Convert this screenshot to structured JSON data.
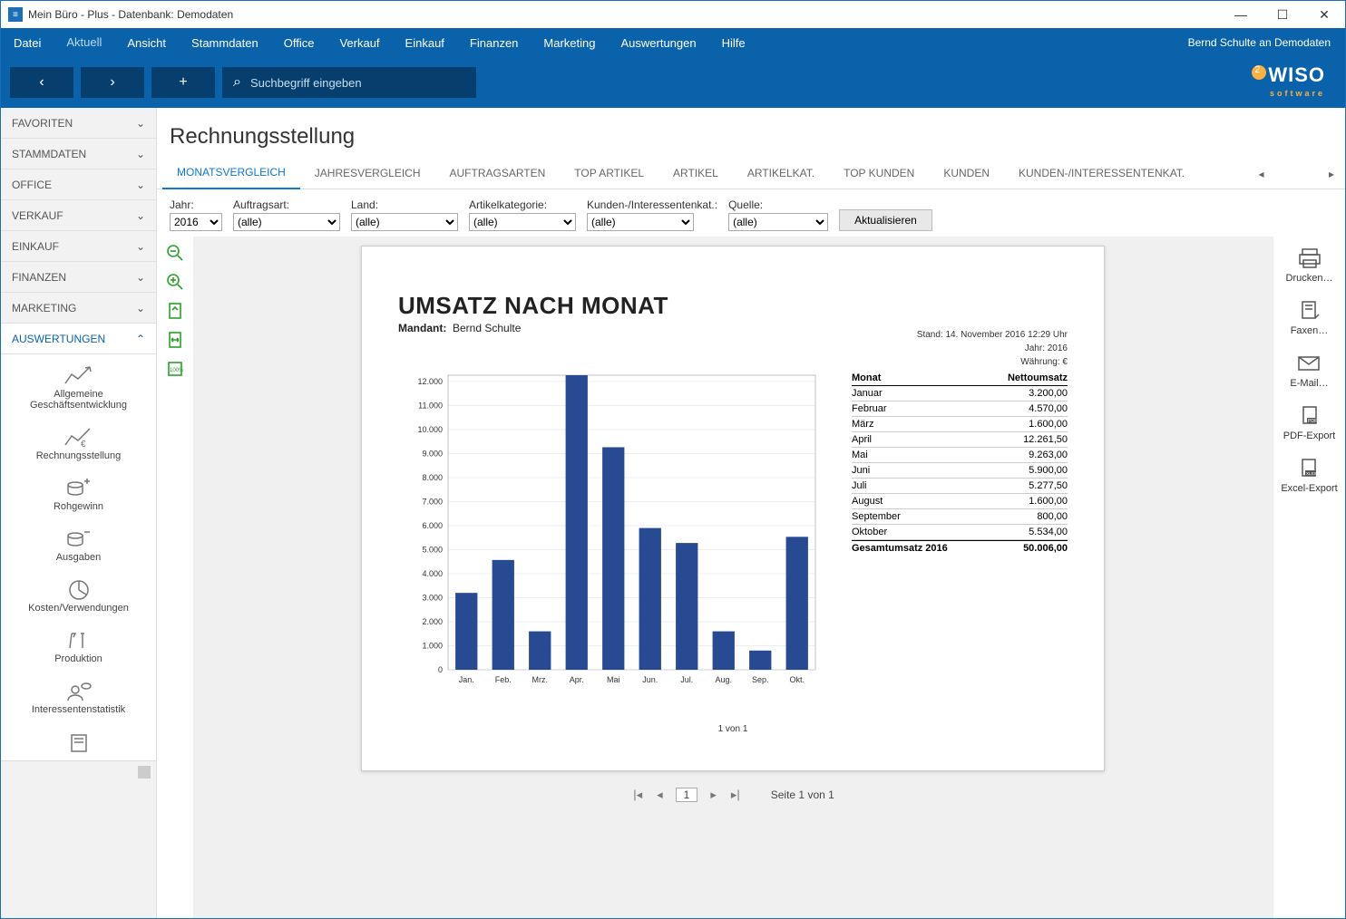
{
  "window": {
    "title": "Mein Büro - Plus - Datenbank: Demodaten"
  },
  "menu": {
    "items": [
      "Datei",
      "Aktuell",
      "Ansicht",
      "Stammdaten",
      "Office",
      "Verkauf",
      "Einkauf",
      "Finanzen",
      "Marketing",
      "Auswertungen",
      "Hilfe"
    ],
    "active_index": 1,
    "user": "Bernd Schulte an Demodaten"
  },
  "toolbar": {
    "search_placeholder": "Suchbegriff eingeben"
  },
  "logo": {
    "brand": "WISO",
    "sub": "software"
  },
  "sidebar": {
    "categories": [
      {
        "label": "FAVORITEN",
        "expanded": false
      },
      {
        "label": "STAMMDATEN",
        "expanded": false
      },
      {
        "label": "OFFICE",
        "expanded": false
      },
      {
        "label": "VERKAUF",
        "expanded": false
      },
      {
        "label": "EINKAUF",
        "expanded": false
      },
      {
        "label": "FINANZEN",
        "expanded": false
      },
      {
        "label": "MARKETING",
        "expanded": false
      },
      {
        "label": "AUSWERTUNGEN",
        "expanded": true
      }
    ],
    "subitems": [
      "Allgemeine Geschäftsentwicklung",
      "Rechnungsstellung",
      "Rohgewinn",
      "Ausgaben",
      "Kosten/Verwendungen",
      "Produktion",
      "Interessentenstatistik"
    ]
  },
  "page": {
    "title": "Rechnungsstellung"
  },
  "tabs": {
    "items": [
      "MONATSVERGLEICH",
      "JAHRESVERGLEICH",
      "AUFTRAGSARTEN",
      "TOP ARTIKEL",
      "ARTIKEL",
      "ARTIKELKAT.",
      "TOP KUNDEN",
      "KUNDEN",
      "KUNDEN-/INTERESSENTENKAT."
    ],
    "active_index": 0
  },
  "filters": {
    "jahr": {
      "label": "Jahr:",
      "value": "2016"
    },
    "auftragsart": {
      "label": "Auftragsart:",
      "value": "(alle)"
    },
    "land": {
      "label": "Land:",
      "value": "(alle)"
    },
    "artikelkat": {
      "label": "Artikelkategorie:",
      "value": "(alle)"
    },
    "kundenkat": {
      "label": "Kunden-/Interessentenkat.:",
      "value": "(alle)"
    },
    "quelle": {
      "label": "Quelle:",
      "value": "(alle)"
    },
    "refresh": "Aktualisieren"
  },
  "report": {
    "title": "UMSATZ NACH MONAT",
    "mandant_label": "Mandant:",
    "mandant_value": "Bernd Schulte",
    "meta_stand": "Stand:  14. November 2016 12:29 Uhr",
    "meta_jahr": "Jahr: 2016",
    "meta_waehrung": "Währung: €",
    "table_header_month": "Monat",
    "table_header_net": "Nettoumsatz",
    "rows": [
      {
        "m": "Januar",
        "v": "3.200,00"
      },
      {
        "m": "Februar",
        "v": "4.570,00"
      },
      {
        "m": "März",
        "v": "1.600,00"
      },
      {
        "m": "April",
        "v": "12.261,50"
      },
      {
        "m": "Mai",
        "v": "9.263,00"
      },
      {
        "m": "Juni",
        "v": "5.900,00"
      },
      {
        "m": "Juli",
        "v": "5.277,50"
      },
      {
        "m": "August",
        "v": "1.600,00"
      },
      {
        "m": "September",
        "v": "800,00"
      },
      {
        "m": "Oktober",
        "v": "5.534,00"
      }
    ],
    "total_label": "Gesamtumsatz 2016",
    "total_value": "50.006,00",
    "page_of": "1 von 1"
  },
  "pager": {
    "current": "1",
    "text": "Seite 1 von 1"
  },
  "actions": {
    "print": "Drucken…",
    "fax": "Faxen…",
    "email": "E-Mail…",
    "pdf": "PDF-Export",
    "excel": "Excel-Export"
  },
  "chart_data": {
    "type": "bar",
    "title": "UMSATZ NACH MONAT",
    "xlabel": "",
    "ylabel": "",
    "ylim": [
      0,
      12000
    ],
    "yticks": [
      0,
      1000,
      2000,
      3000,
      4000,
      5000,
      6000,
      7000,
      8000,
      9000,
      10000,
      11000,
      12000
    ],
    "ytick_labels": [
      "0",
      "1.000",
      "2.000",
      "3.000",
      "4.000",
      "5.000",
      "6.000",
      "7.000",
      "8.000",
      "9.000",
      "10.000",
      "11.000",
      "12.000"
    ],
    "categories": [
      "Jan.",
      "Feb.",
      "Mrz.",
      "Apr.",
      "Mai",
      "Jun.",
      "Jul.",
      "Aug.",
      "Sep.",
      "Okt."
    ],
    "values": [
      3200,
      4570,
      1600,
      12261.5,
      9263,
      5900,
      5277.5,
      1600,
      800,
      5534
    ],
    "bar_color": "#274a93"
  }
}
